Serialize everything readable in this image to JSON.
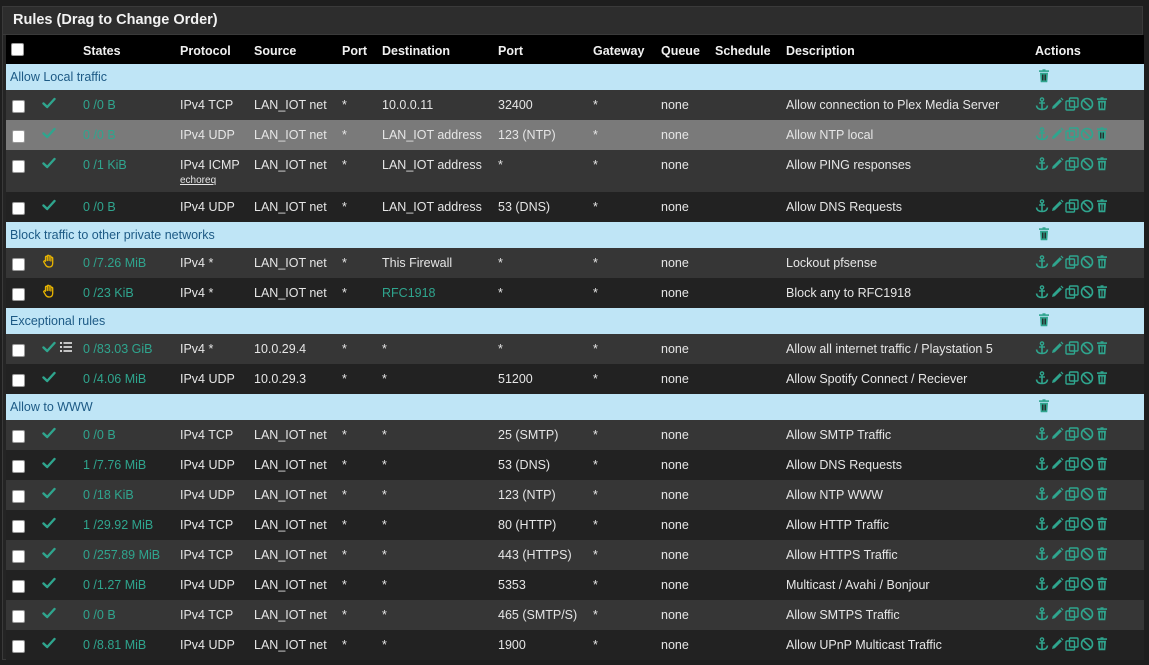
{
  "title": "Rules (Drag to Change Order)",
  "columns": [
    "States",
    "Protocol",
    "Source",
    "Port",
    "Destination",
    "Port",
    "Gateway",
    "Queue",
    "Schedule",
    "Description",
    "Actions"
  ],
  "colors": {
    "accent": "#2fa58e",
    "separator_bg": "#bfe5f6",
    "separator_text": "#1d5a85",
    "pass": "#2fa58e",
    "block": "#e8b400"
  },
  "sections": [
    {
      "label": "Allow Local traffic",
      "rules": [
        {
          "action": "pass",
          "states": "0 /0 B",
          "protocol": "IPv4 TCP",
          "source": "LAN_IOT net",
          "sport": "*",
          "destination": "10.0.0.11",
          "dport": "32400",
          "gateway": "*",
          "queue": "none",
          "schedule": "",
          "description": "Allow connection to Plex Media Server"
        },
        {
          "action": "pass",
          "states": "0 /0 B",
          "protocol": "IPv4 UDP",
          "source": "LAN_IOT net",
          "sport": "*",
          "destination": "LAN_IOT address",
          "dport": "123 (NTP)",
          "gateway": "*",
          "queue": "none",
          "schedule": "",
          "description": "Allow NTP local",
          "highlighted": true
        },
        {
          "action": "pass",
          "states": "0 /1 KiB",
          "protocol": "IPv4 ICMP",
          "protocol_sub": "echoreq",
          "source": "LAN_IOT net",
          "sport": "*",
          "destination": "LAN_IOT address",
          "dport": "*",
          "gateway": "*",
          "queue": "none",
          "schedule": "",
          "description": "Allow PING responses"
        },
        {
          "action": "pass",
          "states": "0 /0 B",
          "protocol": "IPv4 UDP",
          "source": "LAN_IOT net",
          "sport": "*",
          "destination": "LAN_IOT address",
          "dport": "53 (DNS)",
          "gateway": "*",
          "queue": "none",
          "schedule": "",
          "description": "Allow DNS Requests"
        }
      ]
    },
    {
      "label": "Block traffic to other private networks",
      "rules": [
        {
          "action": "block",
          "states": "0 /7.26 MiB",
          "protocol": "IPv4 *",
          "source": "LAN_IOT net",
          "sport": "*",
          "destination": "This Firewall",
          "dport": "*",
          "gateway": "*",
          "queue": "none",
          "schedule": "",
          "description": "Lockout pfsense"
        },
        {
          "action": "block",
          "states": "0 /23 KiB",
          "protocol": "IPv4 *",
          "source": "LAN_IOT net",
          "sport": "*",
          "destination": "RFC1918",
          "destination_link": true,
          "dport": "*",
          "gateway": "*",
          "queue": "none",
          "schedule": "",
          "description": "Block any to RFC1918"
        }
      ]
    },
    {
      "label": "Exceptional rules",
      "rules": [
        {
          "action": "pass",
          "extra_icon": true,
          "states": "0 /83.03 GiB",
          "protocol": "IPv4 *",
          "source": "10.0.29.4",
          "sport": "*",
          "destination": "*",
          "dport": "*",
          "gateway": "*",
          "queue": "none",
          "schedule": "",
          "description": "Allow all internet traffic / Playstation 5"
        },
        {
          "action": "pass",
          "states": "0 /4.06 MiB",
          "protocol": "IPv4 UDP",
          "source": "10.0.29.3",
          "sport": "*",
          "destination": "*",
          "dport": "51200",
          "gateway": "*",
          "queue": "none",
          "schedule": "",
          "description": "Allow Spotify Connect / Reciever"
        }
      ]
    },
    {
      "label": "Allow to WWW",
      "rules": [
        {
          "action": "pass",
          "states": "0 /0 B",
          "protocol": "IPv4 TCP",
          "source": "LAN_IOT net",
          "sport": "*",
          "destination": "*",
          "dport": "25 (SMTP)",
          "gateway": "*",
          "queue": "none",
          "schedule": "",
          "description": "Allow SMTP Traffic"
        },
        {
          "action": "pass",
          "states": "1 /7.76 MiB",
          "protocol": "IPv4 UDP",
          "source": "LAN_IOT net",
          "sport": "*",
          "destination": "*",
          "dport": "53 (DNS)",
          "gateway": "*",
          "queue": "none",
          "schedule": "",
          "description": "Allow DNS Requests"
        },
        {
          "action": "pass",
          "states": "0 /18 KiB",
          "protocol": "IPv4 UDP",
          "source": "LAN_IOT net",
          "sport": "*",
          "destination": "*",
          "dport": "123 (NTP)",
          "gateway": "*",
          "queue": "none",
          "schedule": "",
          "description": "Allow NTP WWW"
        },
        {
          "action": "pass",
          "states": "1 /29.92 MiB",
          "protocol": "IPv4 TCP",
          "source": "LAN_IOT net",
          "sport": "*",
          "destination": "*",
          "dport": "80 (HTTP)",
          "gateway": "*",
          "queue": "none",
          "schedule": "",
          "description": "Allow HTTP Traffic"
        },
        {
          "action": "pass",
          "states": "0 /257.89 MiB",
          "protocol": "IPv4 TCP",
          "source": "LAN_IOT net",
          "sport": "*",
          "destination": "*",
          "dport": "443 (HTTPS)",
          "gateway": "*",
          "queue": "none",
          "schedule": "",
          "description": "Allow HTTPS Traffic"
        },
        {
          "action": "pass",
          "states": "0 /1.27 MiB",
          "protocol": "IPv4 UDP",
          "source": "LAN_IOT net",
          "sport": "*",
          "destination": "*",
          "dport": "5353",
          "gateway": "*",
          "queue": "none",
          "schedule": "",
          "description": "Multicast / Avahi / Bonjour"
        },
        {
          "action": "pass",
          "states": "0 /0 B",
          "protocol": "IPv4 TCP",
          "source": "LAN_IOT net",
          "sport": "*",
          "destination": "*",
          "dport": "465 (SMTP/S)",
          "gateway": "*",
          "queue": "none",
          "schedule": "",
          "description": "Allow SMTPS Traffic"
        },
        {
          "action": "pass",
          "states": "0 /8.81 MiB",
          "protocol": "IPv4 UDP",
          "source": "LAN_IOT net",
          "sport": "*",
          "destination": "*",
          "dport": "1900",
          "gateway": "*",
          "queue": "none",
          "schedule": "",
          "description": "Allow UPnP Multicast Traffic"
        }
      ]
    }
  ]
}
